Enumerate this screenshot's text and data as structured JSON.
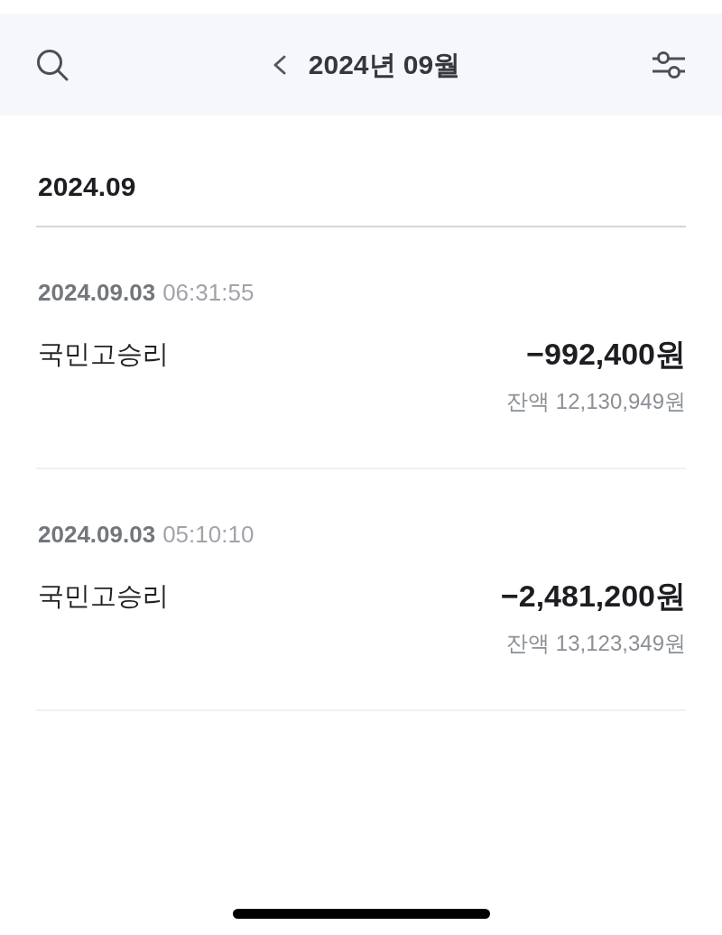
{
  "header": {
    "title": "2024년 09월"
  },
  "month_label": "2024.09",
  "transactions": [
    {
      "date": "2024.09.03",
      "time": "06:31:55",
      "name": "국민고승리",
      "amount": "−992,400원",
      "balance": "잔액 12,130,949원"
    },
    {
      "date": "2024.09.03",
      "time": "05:10:10",
      "name": "국민고승리",
      "amount": "−2,481,200원",
      "balance": "잔액 13,123,349원"
    }
  ]
}
